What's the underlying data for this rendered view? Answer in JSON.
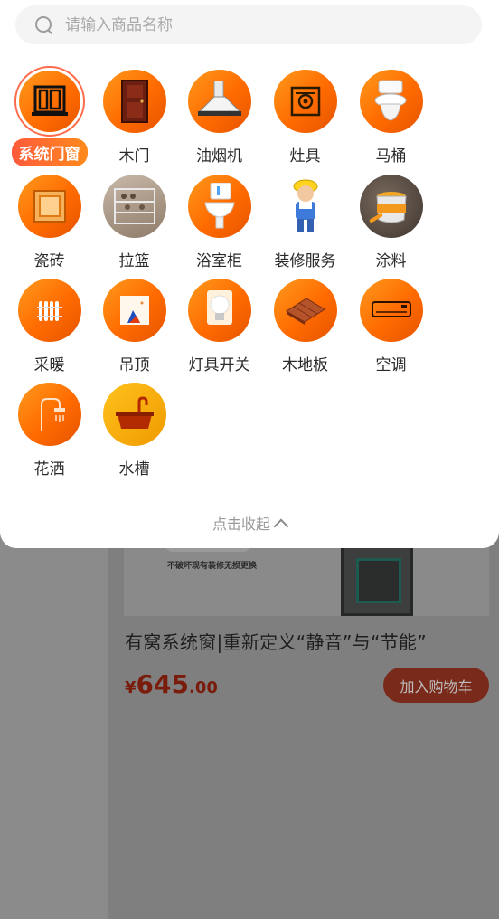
{
  "search": {
    "placeholder": "请输入商品名称"
  },
  "categories": [
    {
      "label": "系统门窗",
      "icon": "window-frame-icon",
      "selected": true
    },
    {
      "label": "木门",
      "icon": "wooden-door-icon"
    },
    {
      "label": "油烟机",
      "icon": "range-hood-icon"
    },
    {
      "label": "灶具",
      "icon": "stove-icon"
    },
    {
      "label": "马桶",
      "icon": "toilet-icon"
    },
    {
      "label": "瓷砖",
      "icon": "tile-icon"
    },
    {
      "label": "拉篮",
      "icon": "pull-basket-icon"
    },
    {
      "label": "浴室柜",
      "icon": "bathroom-cabinet-icon"
    },
    {
      "label": "装修服务",
      "icon": "worker-icon"
    },
    {
      "label": "涂料",
      "icon": "paint-bucket-icon"
    },
    {
      "label": "采暖",
      "icon": "radiator-icon"
    },
    {
      "label": "吊顶",
      "icon": "ceiling-panel-icon"
    },
    {
      "label": "灯具开关",
      "icon": "light-bulb-icon"
    },
    {
      "label": "木地板",
      "icon": "wood-floor-icon"
    },
    {
      "label": "空调",
      "icon": "air-conditioner-icon"
    },
    {
      "label": "花洒",
      "icon": "shower-head-icon"
    },
    {
      "label": "水槽",
      "icon": "sink-icon"
    }
  ],
  "collapse_label": "点击收起",
  "product": {
    "image_caption": "不破坏现有装修无损更换",
    "title": "有窝系统窗|重新定义“静音”与“节能”",
    "price_symbol": "¥",
    "price_int": "645",
    "price_dec": ".00",
    "cart_label": "加入购物车"
  },
  "colors": {
    "accent": "#ff6a00",
    "selected_label_bg": "#ff5a3c"
  }
}
